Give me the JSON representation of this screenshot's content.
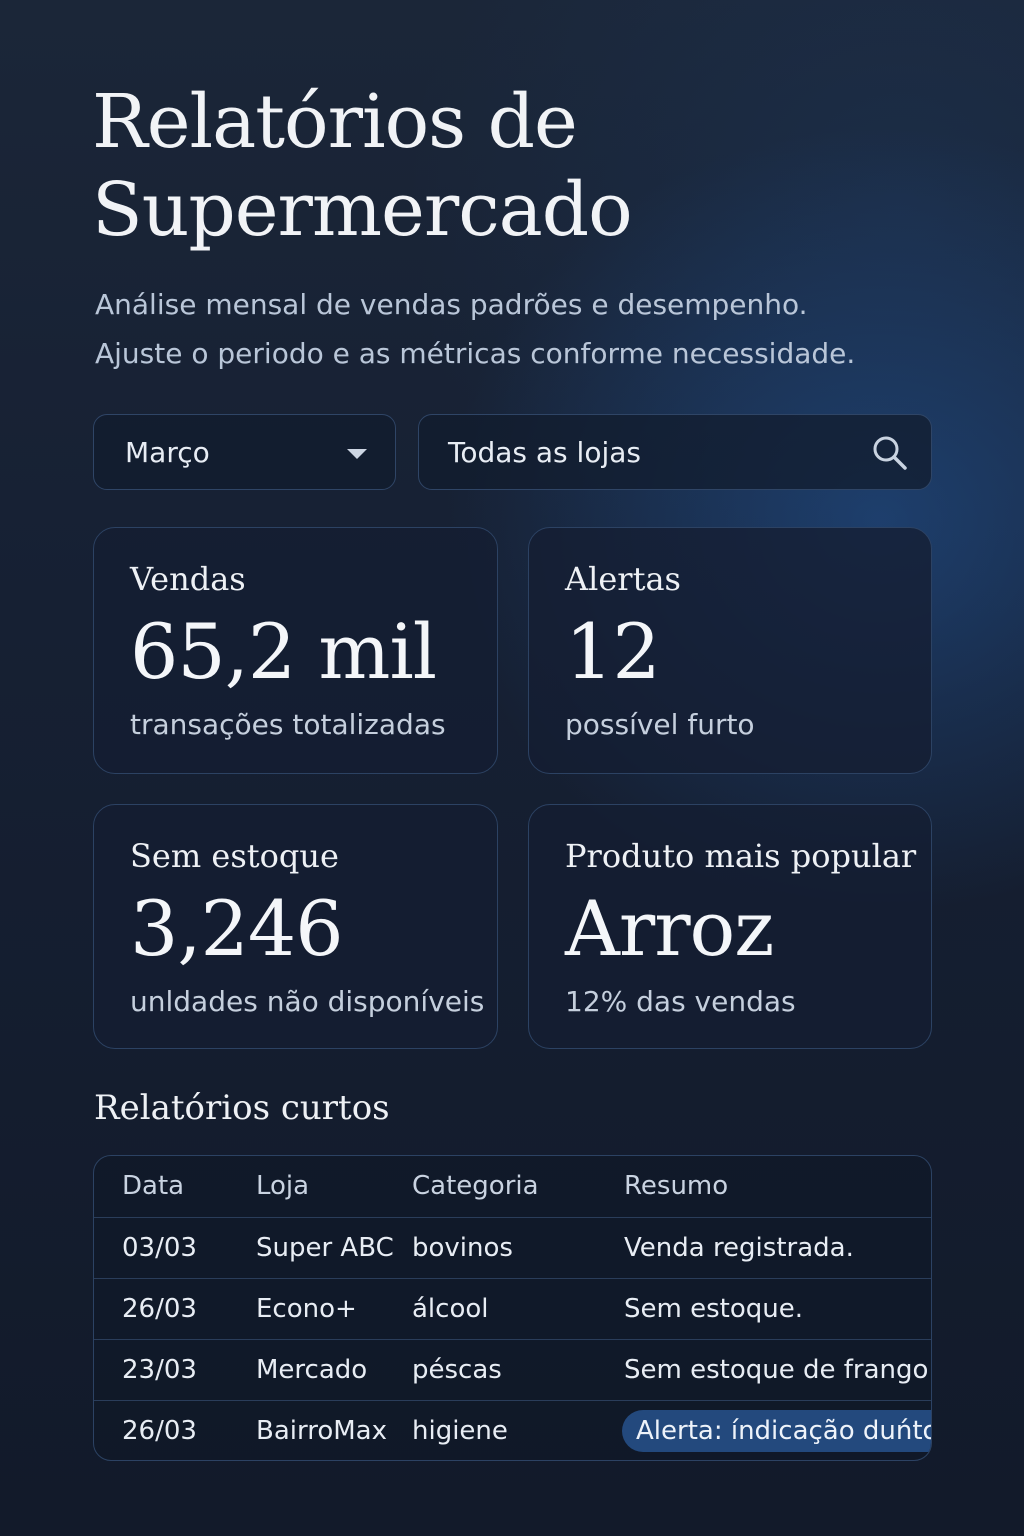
{
  "header": {
    "title_line1": "Relatórios de",
    "title_line2": "Supermercado",
    "subtitle_line1": "Análise mensal de vendas  padrões e desempenho.",
    "subtitle_line2": "Ajuste o periodo e as métricas conforme necessidade."
  },
  "filters": {
    "month_value": "Março",
    "store_value": "Todas as lojas"
  },
  "cards": {
    "sales": {
      "label": "Vendas",
      "value": "65,2 mil",
      "caption": "transações totalizadas"
    },
    "alerts": {
      "label": "Alertas",
      "value": "12",
      "caption": "possível furto"
    },
    "stock": {
      "label": "Sem estoque",
      "value": "3,246",
      "caption": "unldades não disponíveis"
    },
    "popular": {
      "label": "Produto mais popular",
      "value": "Arroz",
      "caption": "12% das vendas"
    }
  },
  "reports": {
    "title": "Relatórios curtos",
    "columns": [
      "Data",
      "Loja",
      "Categoria",
      "Resumo"
    ],
    "rows": [
      {
        "date": "03/03",
        "store": "Super ABC",
        "category": "bovinos",
        "summary": "Venda registrada."
      },
      {
        "date": "26/03",
        "store": "Econo+",
        "category": "álcool",
        "summary": "Sem estoque."
      },
      {
        "date": "23/03",
        "store": "Mercado",
        "category": "péscas",
        "summary": "Sem estoque de frango"
      },
      {
        "date": "26/03",
        "store": "BairroMax",
        "category": "higiene",
        "summary": "Alerta: índicação duńto"
      }
    ]
  },
  "colors": {
    "background": "#162033",
    "card_border": "#2c4263",
    "alert_pill": "#23497d",
    "text_primary": "#e8edf4",
    "text_secondary": "#b9c6d8"
  },
  "icons": {
    "month_select": "chevron-down-icon",
    "store_search": "search-icon"
  }
}
